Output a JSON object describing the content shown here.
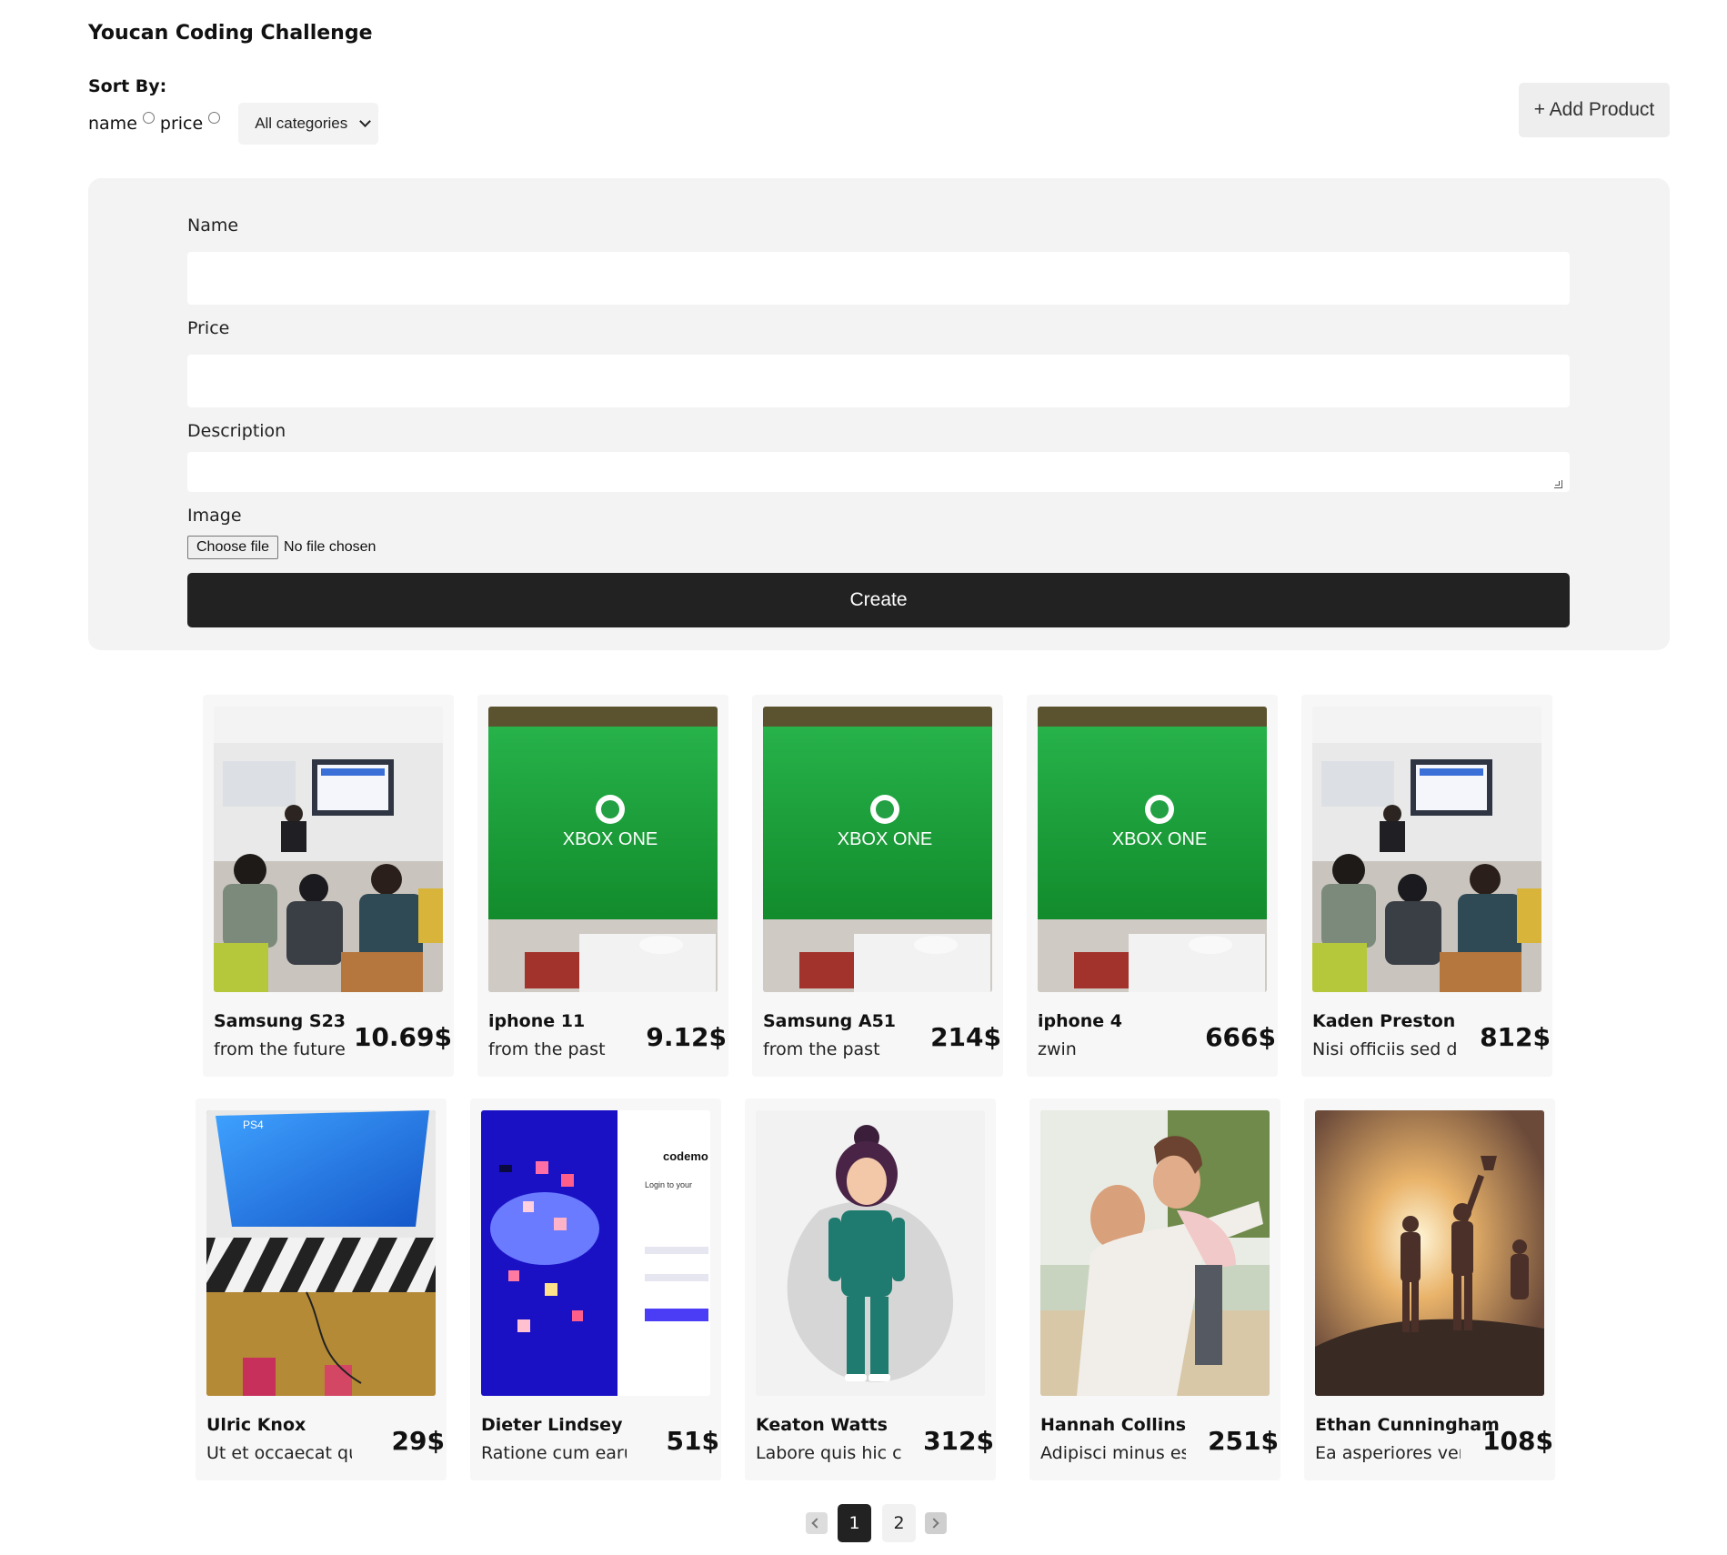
{
  "header": {
    "title": "Youcan Coding Challenge"
  },
  "sort": {
    "label": "Sort By:",
    "options": [
      "name",
      "price"
    ],
    "category_select": "All categories"
  },
  "add_button": "+ Add Product",
  "form": {
    "name_label": "Name",
    "price_label": "Price",
    "description_label": "Description",
    "image_label": "Image",
    "file_button": "Choose file",
    "file_status": "No file chosen",
    "submit": "Create"
  },
  "products": [
    {
      "name": "Samsung S23",
      "desc": "from the future",
      "price": "10.69$",
      "image": "classroom-photo"
    },
    {
      "name": "iphone 11",
      "desc": "from the past",
      "price": "9.12$",
      "image": "xbox-one-photo"
    },
    {
      "name": "Samsung A51",
      "desc": "from the past",
      "price": "214$",
      "image": "xbox-one-photo"
    },
    {
      "name": "iphone 4",
      "desc": "zwin",
      "price": "666$",
      "image": "xbox-one-photo"
    },
    {
      "name": "Kaden Preston",
      "desc": "Nisi officiis sed do",
      "price": "812$",
      "image": "classroom-photo"
    },
    {
      "name": "Ulric Knox",
      "desc": "Ut et occaecat qui a",
      "price": "29$",
      "image": "ps4-tv-photo"
    },
    {
      "name": "Dieter Lindsey",
      "desc": "Ratione cum earum do",
      "price": "51$",
      "image": "codemo-login-screenshot"
    },
    {
      "name": "Keaton Watts",
      "desc": "Labore quis hic comm",
      "price": "312$",
      "image": "cartoon-girl-illustration"
    },
    {
      "name": "Hannah Collins",
      "desc": "Adipisci minus est n",
      "price": "251$",
      "image": "happy-couple-photo"
    },
    {
      "name": "Ethan Cunningham",
      "desc": "Ea asperiores veniam",
      "price": "108$",
      "image": "summit-silhouettes-photo"
    }
  ],
  "image_text": {
    "xbox": "XBOX ONE",
    "codemo": "codemo",
    "login": "Login to your"
  },
  "pagination": {
    "pages": [
      "1",
      "2"
    ],
    "current": "1"
  },
  "colors": {
    "create_button": "#222222",
    "panel_bg": "#f3f3f3",
    "card_bg": "#f7f7f7"
  }
}
